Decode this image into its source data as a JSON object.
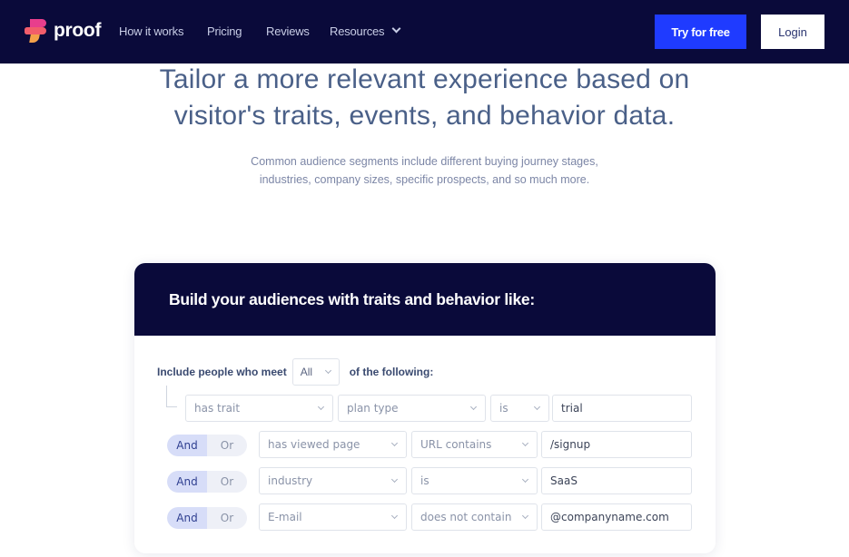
{
  "nav": {
    "logo_text": "proof",
    "links": [
      "How it works",
      "Pricing",
      "Reviews",
      "Resources"
    ],
    "try_label": "Try for free",
    "login_label": "Login"
  },
  "hero": {
    "title_line1": "Tailor a more relevant experience based on",
    "title_line2": "visitor's traits, events, and behavior data.",
    "sub_line1": "Common audience segments include different buying journey stages,",
    "sub_line2": "industries, company sizes, specific prospects, and so much more."
  },
  "card": {
    "title": "Build your audiences with traits and behavior like:",
    "include_label": "Include people who meet",
    "match_value": "All",
    "of_label": "of the following:",
    "rows": [
      {
        "type": "has trait",
        "property": "plan type",
        "operator": "is",
        "value": "trial"
      },
      {
        "logic": "And",
        "alt": "Or",
        "type": "has viewed page",
        "operator": "URL contains",
        "value": "/signup"
      },
      {
        "logic": "And",
        "alt": "Or",
        "type": "industry",
        "operator": "is",
        "value": "SaaS"
      },
      {
        "logic": "And",
        "alt": "Or",
        "type": "E-mail",
        "operator": "does not contain",
        "value": "@companyname.com"
      }
    ]
  }
}
